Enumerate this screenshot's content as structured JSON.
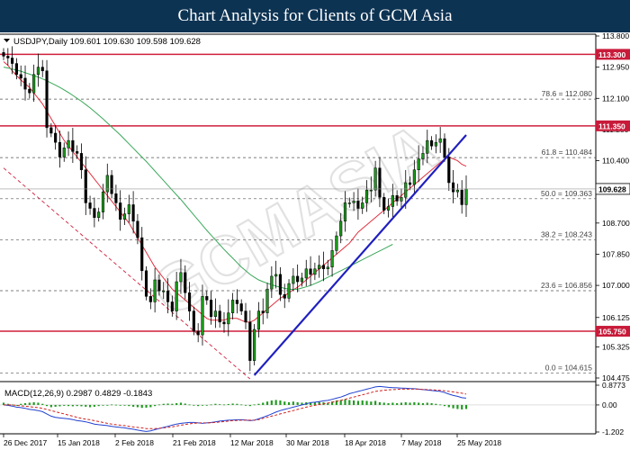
{
  "header": {
    "title": "Chart Analysis for Clients of GCM Asia"
  },
  "colors": {
    "header_bg": "#0d3353",
    "candle": "#1b9a1b",
    "ma_fast": "#e0303f",
    "ma_slow": "#3aa85a",
    "resistance": "#d11f3c",
    "trendline": "#1f1fc0",
    "macd_line": "#2040d0",
    "signal_line": "#d02020",
    "histogram": "#1f9a1f",
    "price_tag": "#ffffff",
    "level_tag": "#c81b3a"
  },
  "price_panel": {
    "info": "USDJPY,Daily  109.601 109.630 109.598 109.628",
    "current_price_label": "109.628",
    "price_axis_labels": [
      "113.800",
      "112.950",
      "112.100",
      "111.250",
      "110.400",
      "109.550",
      "108.700",
      "107.850",
      "107.000",
      "106.125",
      "105.325",
      "104.475"
    ],
    "horizontal_levels": [
      {
        "label": "113.300"
      },
      {
        "label": "111.350"
      },
      {
        "label": "105.750"
      }
    ],
    "fib_levels": [
      {
        "label": "78.6 = 112.080"
      },
      {
        "label": "61.8 = 110.484"
      },
      {
        "label": "50.0 = 109.363"
      },
      {
        "label": "38.2 = 108.243"
      },
      {
        "label": "23.6 = 106.856"
      },
      {
        "label": "0.0 = 104.615"
      }
    ]
  },
  "macd_panel": {
    "info": "MACD(12,26,9) 0.2987 0.4829 -0.1843",
    "axis_labels": [
      "0.8773",
      "0.00",
      "-1.202"
    ]
  },
  "x_axis_labels": [
    "26 Dec 2017",
    "15 Jan 2018",
    "2 Feb 2018",
    "21 Feb 2018",
    "12 Mar 2018",
    "30 Mar 2018",
    "18 Apr 2018",
    "7 May 2018",
    "25 May 2018"
  ],
  "watermark": {
    "text": "GCMASIA",
    "brand_text": "GCMASIA"
  },
  "chart_data": [
    {
      "type": "candlestick",
      "title": "USDJPY,Daily",
      "ylim": [
        104.475,
        113.8
      ],
      "x_labels": [
        "26 Dec 2017",
        "15 Jan 2018",
        "2 Feb 2018",
        "21 Feb 2018",
        "12 Mar 2018",
        "30 Mar 2018",
        "18 Apr 2018",
        "7 May 2018",
        "25 May 2018"
      ],
      "close": [
        113.25,
        113.2,
        113.05,
        112.75,
        112.65,
        112.35,
        112.25,
        112.75,
        112.95,
        112.85,
        111.3,
        111.15,
        110.9,
        110.5,
        110.75,
        110.95,
        110.65,
        110.6,
        110.15,
        109.25,
        109.1,
        108.85,
        109.0,
        109.55,
        110.0,
        109.5,
        109.25,
        108.8,
        108.95,
        109.2,
        108.75,
        108.3,
        107.4,
        106.7,
        106.55,
        107.15,
        106.85,
        106.85,
        106.55,
        106.3,
        107.1,
        107.35,
        106.8,
        106.3,
        105.75,
        105.65,
        106.7,
        106.6,
        106.15,
        106.3,
        106.0,
        105.95,
        106.25,
        106.6,
        106.5,
        106.3,
        106.0,
        104.95,
        105.8,
        106.3,
        106.25,
        106.9,
        107.25,
        107.3,
        106.75,
        106.65,
        107.05,
        107.25,
        107.1,
        107.2,
        107.45,
        107.3,
        107.45,
        107.55,
        107.45,
        107.5,
        107.95,
        108.35,
        108.75,
        109.25,
        109.25,
        109.3,
        109.1,
        109.25,
        109.6,
        109.6,
        110.2,
        109.4,
        109.05,
        109.15,
        109.45,
        109.3,
        109.4,
        109.8,
        109.75,
        110.15,
        110.45,
        110.6,
        110.95,
        110.8,
        110.9,
        111.0,
        110.5,
        109.8,
        109.55,
        109.6,
        109.2,
        109.63
      ],
      "series": [
        {
          "name": "MA fast",
          "values": [
            113.1,
            113.0,
            112.85,
            112.72,
            112.6,
            112.5,
            112.4,
            112.25,
            112.1,
            111.95,
            111.75,
            111.55,
            111.35,
            111.15,
            110.95,
            110.8,
            110.65,
            110.5,
            110.35,
            110.2,
            110.05,
            109.9,
            109.75,
            109.6,
            109.45,
            109.3,
            109.15,
            109.0,
            108.85,
            108.7,
            108.5,
            108.3,
            108.1,
            107.9,
            107.7,
            107.5,
            107.35,
            107.2,
            107.05,
            106.9,
            106.8,
            106.7,
            106.6,
            106.5,
            106.4,
            106.3,
            106.2,
            106.1,
            106.05,
            106.05,
            106.05,
            106.05,
            106.1,
            106.1,
            106.1,
            106.05,
            106.0,
            106.0,
            106.05,
            106.15,
            106.25,
            106.35,
            106.45,
            106.55,
            106.65,
            106.72,
            106.8,
            106.88,
            106.95,
            107.05,
            107.15,
            107.25,
            107.35,
            107.45,
            107.55,
            107.65,
            107.75,
            107.85,
            107.95,
            108.05,
            108.15,
            108.3,
            108.45,
            108.55,
            108.65,
            108.75,
            108.85,
            108.95,
            109.05,
            109.15,
            109.25,
            109.35,
            109.45,
            109.55,
            109.65,
            109.75,
            109.85,
            109.95,
            110.05,
            110.15,
            110.25,
            110.35,
            110.45,
            110.5,
            110.45,
            110.4,
            110.3,
            110.25
          ]
        },
        {
          "name": "MA slow",
          "values": [
            112.95,
            112.93,
            112.9,
            112.87,
            112.84,
            112.8,
            112.76,
            112.72,
            112.68,
            112.63,
            112.58,
            112.52,
            112.46,
            112.4,
            112.33,
            112.26,
            112.18,
            112.1,
            112.02,
            111.93,
            111.84,
            111.74,
            111.64,
            111.54,
            111.43,
            111.32,
            111.21,
            111.1,
            110.98,
            110.86,
            110.74,
            110.62,
            110.5,
            110.38,
            110.25,
            110.12,
            109.99,
            109.86,
            109.73,
            109.6,
            109.47,
            109.34,
            109.2,
            109.06,
            108.92,
            108.78,
            108.64,
            108.5,
            108.37,
            108.24,
            108.11,
            107.98,
            107.86,
            107.74,
            107.62,
            107.5,
            107.4,
            107.3,
            107.22,
            107.15,
            107.1,
            107.06,
            107.02,
            106.98,
            106.95,
            106.92,
            106.9,
            106.89,
            106.9,
            106.93,
            106.96,
            107.0,
            107.05,
            107.1,
            107.16,
            107.22,
            107.28,
            107.34,
            107.4,
            107.46,
            107.52,
            107.58,
            107.64,
            107.7,
            107.76,
            107.82,
            107.88,
            107.94,
            108.0,
            108.06,
            108.12
          ]
        }
      ],
      "fib_levels": [
        {
          "ratio": 78.6,
          "value": 112.08
        },
        {
          "ratio": 61.8,
          "value": 110.484
        },
        {
          "ratio": 50.0,
          "value": 109.363
        },
        {
          "ratio": 38.2,
          "value": 108.243
        },
        {
          "ratio": 23.6,
          "value": 106.856
        },
        {
          "ratio": 0.0,
          "value": 104.615
        }
      ],
      "horizontal_levels": [
        113.3,
        111.35,
        105.75
      ],
      "trendline": [
        {
          "bar": 58,
          "value": 104.55
        },
        {
          "bar": 107,
          "value": 111.1
        }
      ]
    },
    {
      "type": "bar",
      "title": "MACD(12,26,9)",
      "ylim": [
        -1.202,
        0.8773
      ],
      "histogram": [
        0.1,
        0.05,
        0.02,
        0.0,
        0.05,
        0.08,
        0.1,
        0.12,
        0.1,
        0.05,
        -0.05,
        -0.1,
        -0.08,
        -0.06,
        -0.04,
        -0.05,
        -0.06,
        -0.05,
        -0.06,
        -0.08,
        -0.1,
        -0.08,
        -0.05,
        -0.02,
        0.0,
        0.02,
        0.01,
        -0.02,
        -0.03,
        -0.05,
        -0.08,
        -0.1,
        -0.13,
        -0.12,
        -0.1,
        -0.05,
        0.02,
        0.05,
        0.06,
        0.05,
        0.08,
        0.1,
        0.06,
        0.02,
        -0.02,
        -0.05,
        -0.03,
        0.0,
        0.02,
        0.05,
        0.03,
        0.02,
        0.04,
        0.06,
        0.05,
        0.02,
        0.0,
        -0.05,
        0.02,
        0.05,
        0.1,
        0.15,
        0.2,
        0.22,
        0.2,
        0.15,
        0.12,
        0.15,
        0.12,
        0.1,
        0.12,
        0.1,
        0.12,
        0.15,
        0.12,
        0.1,
        0.15,
        0.2,
        0.22,
        0.25,
        0.22,
        0.2,
        0.18,
        0.2,
        0.18,
        0.15,
        0.18,
        0.12,
        0.1,
        0.08,
        0.1,
        0.08,
        0.1,
        0.12,
        0.1,
        0.12,
        0.1,
        0.08,
        0.1,
        0.08,
        0.05,
        0.02,
        -0.05,
        -0.1,
        -0.15,
        -0.18,
        -0.2,
        -0.18
      ],
      "series": [
        {
          "name": "MACD",
          "values": [
            0.0,
            -0.02,
            -0.05,
            -0.1,
            -0.12,
            -0.15,
            -0.2,
            -0.22,
            -0.25,
            -0.3,
            -0.4,
            -0.5,
            -0.55,
            -0.58,
            -0.6,
            -0.62,
            -0.65,
            -0.7,
            -0.72,
            -0.75,
            -0.8,
            -0.85,
            -0.88,
            -0.9,
            -0.92,
            -0.95,
            -0.98,
            -1.0,
            -1.02,
            -1.05,
            -1.08,
            -1.12,
            -1.15,
            -1.18,
            -1.15,
            -1.1,
            -1.05,
            -1.0,
            -0.95,
            -0.9,
            -0.85,
            -0.82,
            -0.8,
            -0.78,
            -0.78,
            -0.8,
            -0.82,
            -0.8,
            -0.78,
            -0.75,
            -0.72,
            -0.7,
            -0.68,
            -0.67,
            -0.66,
            -0.66,
            -0.67,
            -0.7,
            -0.68,
            -0.62,
            -0.55,
            -0.48,
            -0.4,
            -0.32,
            -0.25,
            -0.2,
            -0.15,
            -0.1,
            -0.05,
            0.0,
            0.05,
            0.1,
            0.12,
            0.15,
            0.18,
            0.2,
            0.25,
            0.3,
            0.35,
            0.42,
            0.5,
            0.55,
            0.6,
            0.65,
            0.7,
            0.75,
            0.8,
            0.82,
            0.8,
            0.78,
            0.77,
            0.76,
            0.75,
            0.74,
            0.73,
            0.72,
            0.7,
            0.68,
            0.66,
            0.64,
            0.62,
            0.6,
            0.55,
            0.48,
            0.42,
            0.38,
            0.32,
            0.3
          ]
        },
        {
          "name": "Signal",
          "values": [
            0.0,
            0.0,
            0.0,
            -0.02,
            -0.04,
            -0.06,
            -0.08,
            -0.1,
            -0.12,
            -0.15,
            -0.2,
            -0.25,
            -0.3,
            -0.35,
            -0.4,
            -0.45,
            -0.5,
            -0.55,
            -0.6,
            -0.63,
            -0.66,
            -0.7,
            -0.74,
            -0.78,
            -0.82,
            -0.85,
            -0.88,
            -0.9,
            -0.92,
            -0.95,
            -0.98,
            -1.0,
            -1.02,
            -1.05,
            -1.05,
            -1.05,
            -1.04,
            -1.02,
            -1.0,
            -0.97,
            -0.94,
            -0.9,
            -0.87,
            -0.84,
            -0.82,
            -0.8,
            -0.8,
            -0.8,
            -0.79,
            -0.78,
            -0.76,
            -0.74,
            -0.72,
            -0.7,
            -0.69,
            -0.68,
            -0.68,
            -0.68,
            -0.68,
            -0.65,
            -0.6,
            -0.55,
            -0.5,
            -0.45,
            -0.4,
            -0.35,
            -0.3,
            -0.25,
            -0.2,
            -0.15,
            -0.1,
            -0.05,
            -0.02,
            0.02,
            0.05,
            0.08,
            0.12,
            0.16,
            0.2,
            0.25,
            0.3,
            0.35,
            0.4,
            0.45,
            0.5,
            0.55,
            0.6,
            0.63,
            0.65,
            0.67,
            0.68,
            0.69,
            0.7,
            0.7,
            0.7,
            0.7,
            0.7,
            0.69,
            0.68,
            0.67,
            0.66,
            0.65,
            0.63,
            0.6,
            0.58,
            0.55,
            0.52,
            0.48
          ]
        }
      ]
    }
  ]
}
